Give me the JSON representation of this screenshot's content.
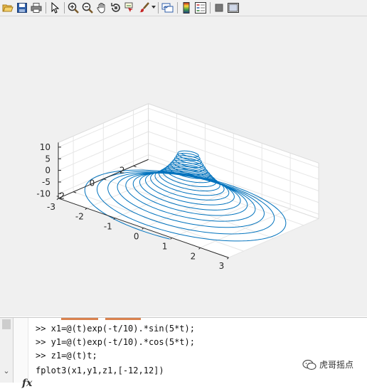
{
  "toolbar": {
    "tools": [
      "open-icon",
      "save-icon",
      "print-icon",
      "pointer-icon",
      "zoom-in-icon",
      "zoom-out-icon",
      "pan-icon",
      "rotate-3d-icon",
      "data-cursor-icon",
      "brush-icon",
      "link-plot-icon",
      "colorbar-icon",
      "legend-icon",
      "hide-plot-tools-icon",
      "show-plot-tools-icon"
    ]
  },
  "colors": {
    "curve": "#0072BD",
    "background": "#f0f0f0",
    "axes_bg": "#ffffff",
    "grid": "#e6e6e6",
    "axis": "#262626"
  },
  "chart_data": {
    "type": "line",
    "dimension": "3d",
    "series": [
      {
        "x": "exp(-t/10).*sin(5*t)",
        "y": "exp(-t/10).*cos(5*t)",
        "z": "t",
        "t_range": [
          -12,
          12
        ]
      }
    ],
    "xlim": [
      -3,
      3
    ],
    "ylim": [
      -3,
      3
    ],
    "zlim": [
      -12,
      12
    ],
    "xticks": [
      "-3",
      "-2",
      "-1",
      "0",
      "1",
      "2",
      "3"
    ],
    "yticks": [
      "-2",
      "0",
      "2"
    ],
    "zticks": [
      "-10",
      "-5",
      "0",
      "5",
      "10"
    ],
    "grid": true
  },
  "command_window": {
    "lines": [
      ">> x1=@(t)exp(-t/10).*sin(5*t);",
      ">> y1=@(t)exp(-t/10).*cos(5*t);",
      ">> z1=@(t)t;",
      "fplot3(x1,y1,z1,[-12,12])"
    ],
    "fx": "fx"
  },
  "watermark": {
    "text": "虎哥摇点"
  }
}
